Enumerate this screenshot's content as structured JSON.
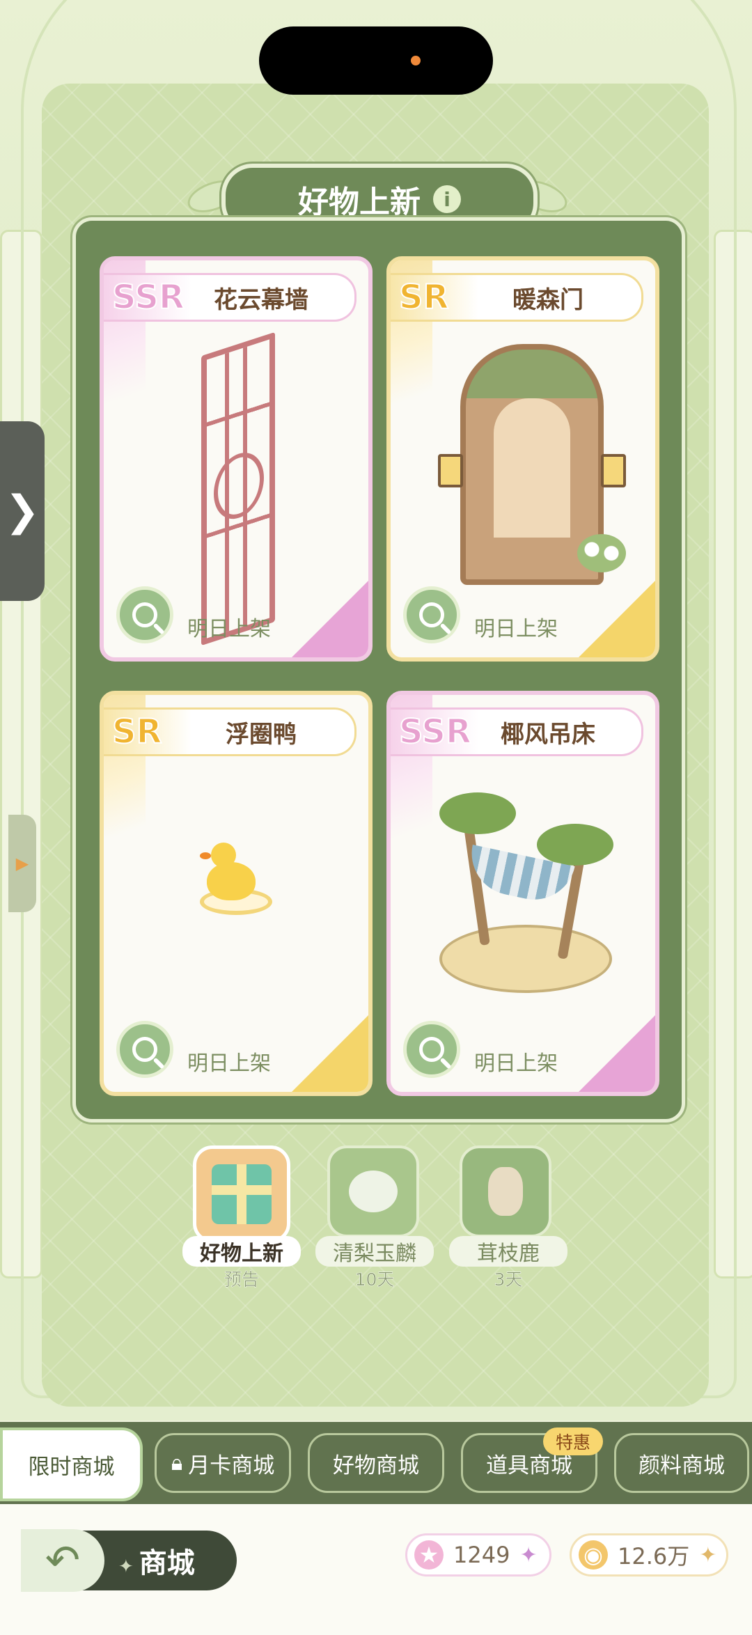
{
  "header": {
    "title": "好物上新",
    "info_icon": "info-icon"
  },
  "cards": [
    {
      "rarity": "SSR",
      "name": "花云幕墙",
      "status": "明日上架",
      "tone": "pink"
    },
    {
      "rarity": "SR",
      "name": "暖森门",
      "status": "明日上架",
      "tone": "gold"
    },
    {
      "rarity": "SR",
      "name": "浮圈鸭",
      "status": "明日上架",
      "tone": "gold"
    },
    {
      "rarity": "SSR",
      "name": "椰风吊床",
      "status": "明日上架",
      "tone": "pink"
    }
  ],
  "banners": [
    {
      "label": "好物上新",
      "sub": "预告",
      "selected": true
    },
    {
      "label": "清梨玉麟",
      "sub": "10天",
      "selected": false
    },
    {
      "label": "茸枝鹿",
      "sub": "3天",
      "selected": false
    }
  ],
  "shop_tabs": [
    {
      "label": "限时商城",
      "active": true
    },
    {
      "label": "月卡商城",
      "locked": true
    },
    {
      "label": "好物商城"
    },
    {
      "label": "道具商城",
      "badge": "特惠"
    },
    {
      "label": "颜料商城"
    }
  ],
  "footer": {
    "title": "商城",
    "currency_star": "1249",
    "currency_coin": "12.6万"
  },
  "colors": {
    "board": "#6e8a58",
    "accent_pink": "#e7a1cf",
    "accent_gold": "#f0b431"
  }
}
